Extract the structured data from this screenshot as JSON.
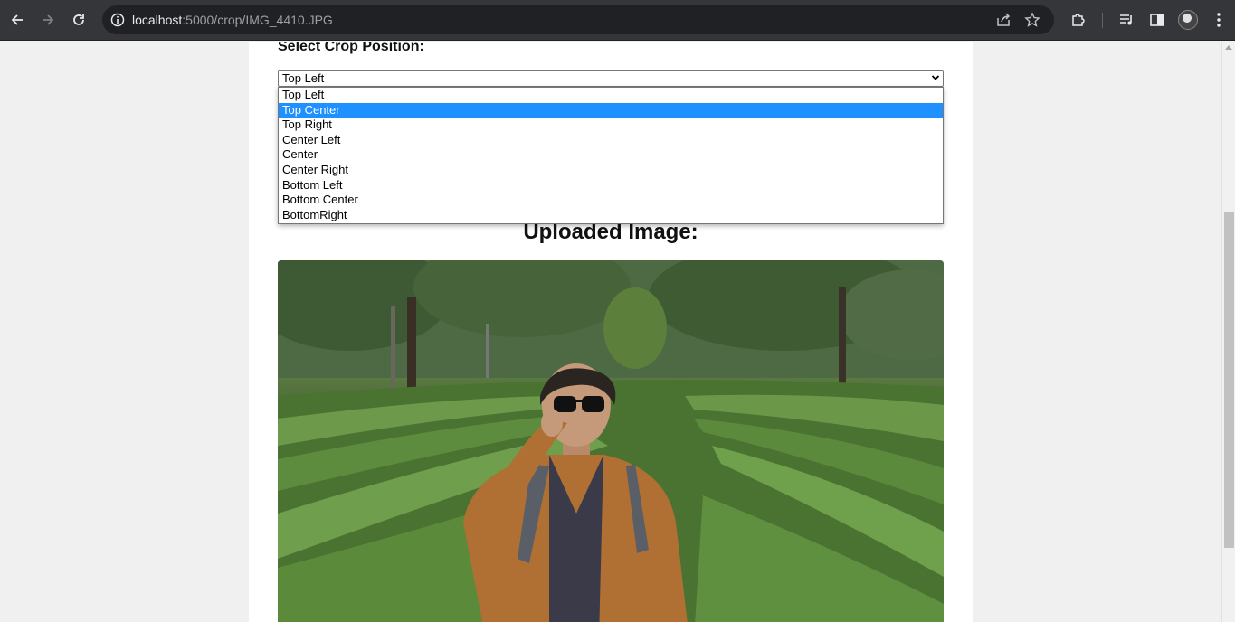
{
  "browser": {
    "url_host": "localhost",
    "url_path": ":5000/crop/IMG_4410.JPG",
    "icons": [
      "back-icon",
      "forward-icon",
      "reload-icon",
      "info-icon",
      "share-icon",
      "star-icon",
      "extensions-icon",
      "media-icon",
      "side-panel-icon",
      "avatar",
      "menu-icon"
    ]
  },
  "page": {
    "crop_label": "Select Crop Position:",
    "select": {
      "current_value": "Top Left",
      "highlighted": "Top Center",
      "options": [
        "Top Left",
        "Top Center",
        "Top Right",
        "Center Left",
        "Center",
        "Center Right",
        "Bottom Left",
        "Bottom Center",
        "BottomRight"
      ]
    },
    "uploaded_title": "Uploaded Image:"
  },
  "colors": {
    "chrome_bg": "#35363a",
    "omnibox_bg": "#202124",
    "highlight": "#1e90ff"
  }
}
